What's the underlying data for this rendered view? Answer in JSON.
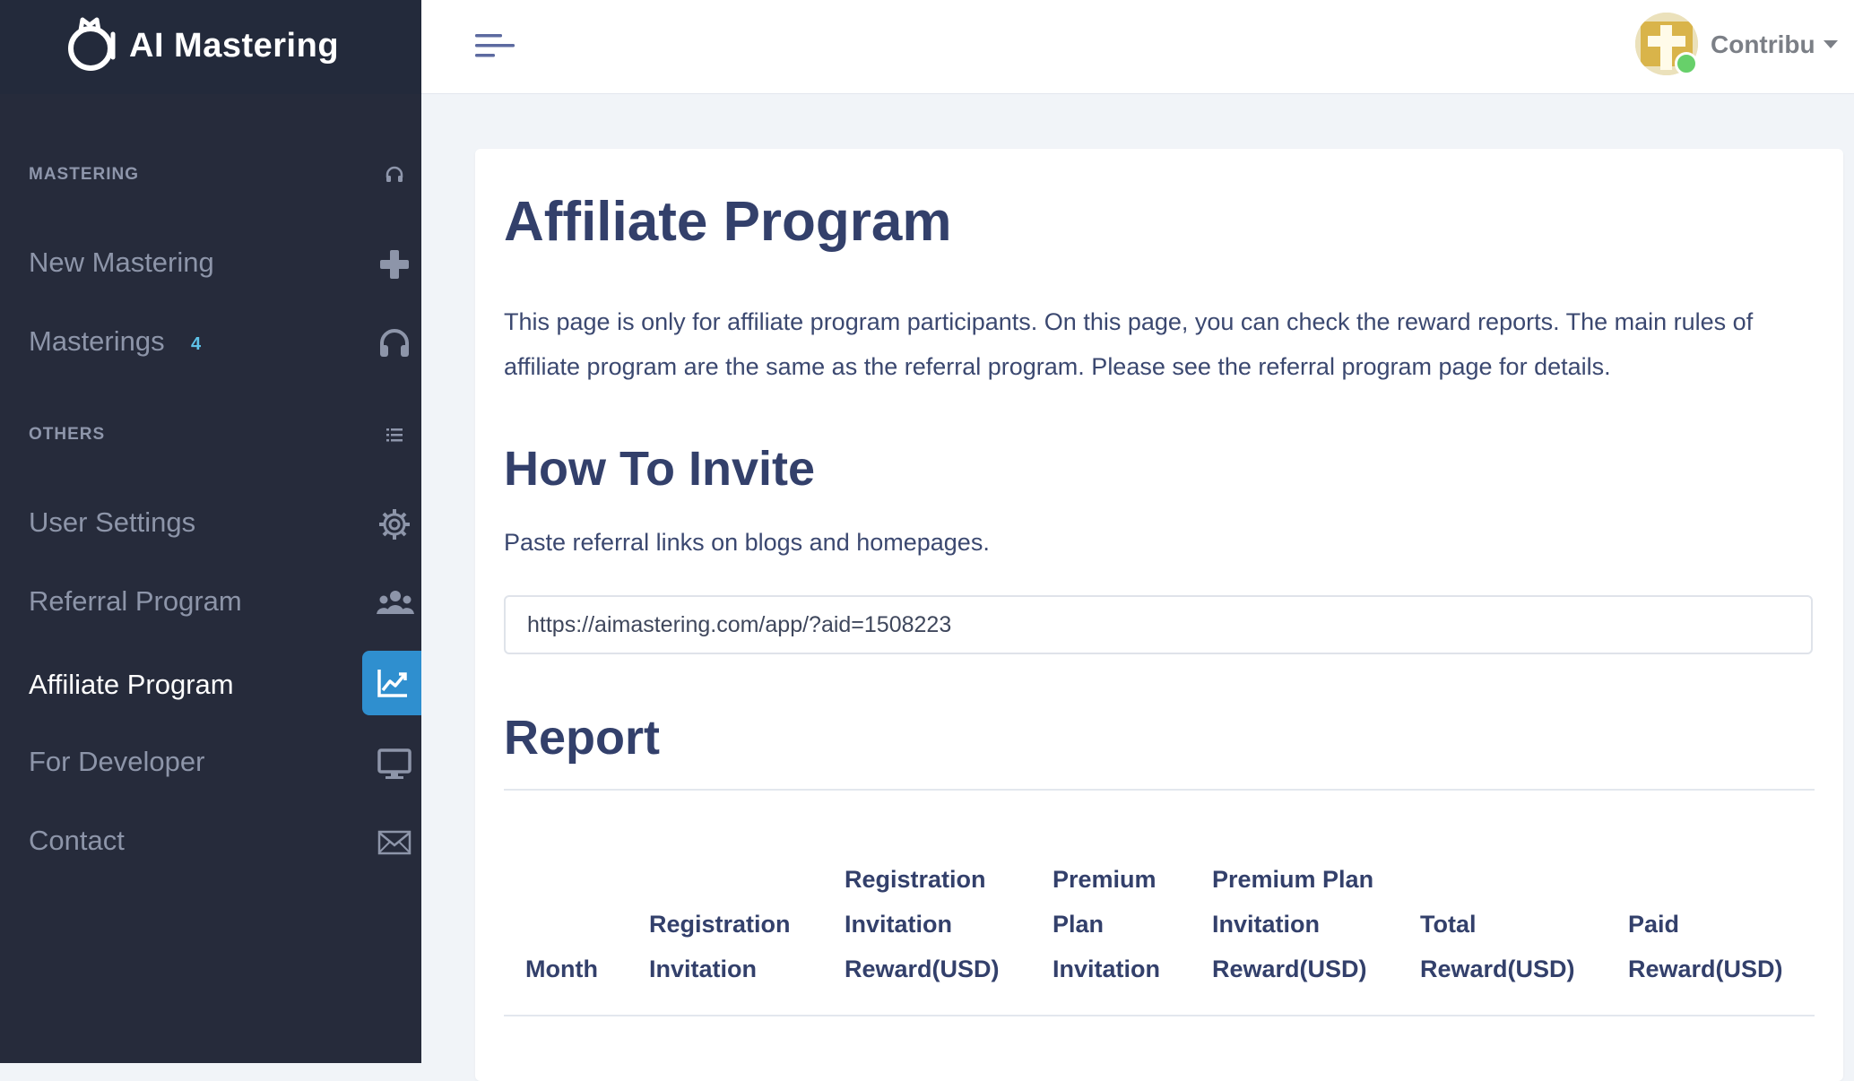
{
  "brand": {
    "name": "AI Mastering"
  },
  "sidebar": {
    "sections": [
      {
        "title": "MASTERING",
        "icon": "headphones-icon"
      },
      {
        "title": "OTHERS",
        "icon": "list-icon"
      }
    ],
    "items": [
      {
        "label": "New Mastering",
        "icon": "plus-icon"
      },
      {
        "label": "Masterings",
        "badge": "4",
        "icon": "headphones-icon"
      },
      {
        "label": "User Settings",
        "icon": "gear-icon"
      },
      {
        "label": "Referral Program",
        "icon": "users-icon"
      },
      {
        "label": "Affiliate Program",
        "icon": "chart-line-icon",
        "active": true
      },
      {
        "label": "For Developer",
        "icon": "monitor-icon"
      },
      {
        "label": "Contact",
        "icon": "envelope-icon"
      }
    ]
  },
  "header": {
    "user_name": "Contribu",
    "user_status": "online"
  },
  "main": {
    "title": "Affiliate Program",
    "description": "This page is only for affiliate program participants. On this page, you can check the reward reports. The main rules of affiliate program are the same as the referral program. Please see the referral program page for details.",
    "how_to_invite": {
      "title": "How To Invite",
      "text": "Paste referral links on blogs and homepages.",
      "link_value": "https://aimastering.com/app/?aid=1508223"
    },
    "report": {
      "title": "Report",
      "columns": [
        "Month",
        "Registration Invitation",
        "Registration Invitation Reward(USD)",
        "Premium Plan Invitation",
        "Premium Plan Invitation Reward(USD)",
        "Total Reward(USD)",
        "Paid Reward(USD)"
      ]
    }
  },
  "colors": {
    "sidebar_bg": "#262b3b",
    "brand_bg": "#232a3b",
    "accent": "#2f8fcf",
    "heading": "#33406b",
    "badge": "#5ec3e9"
  }
}
